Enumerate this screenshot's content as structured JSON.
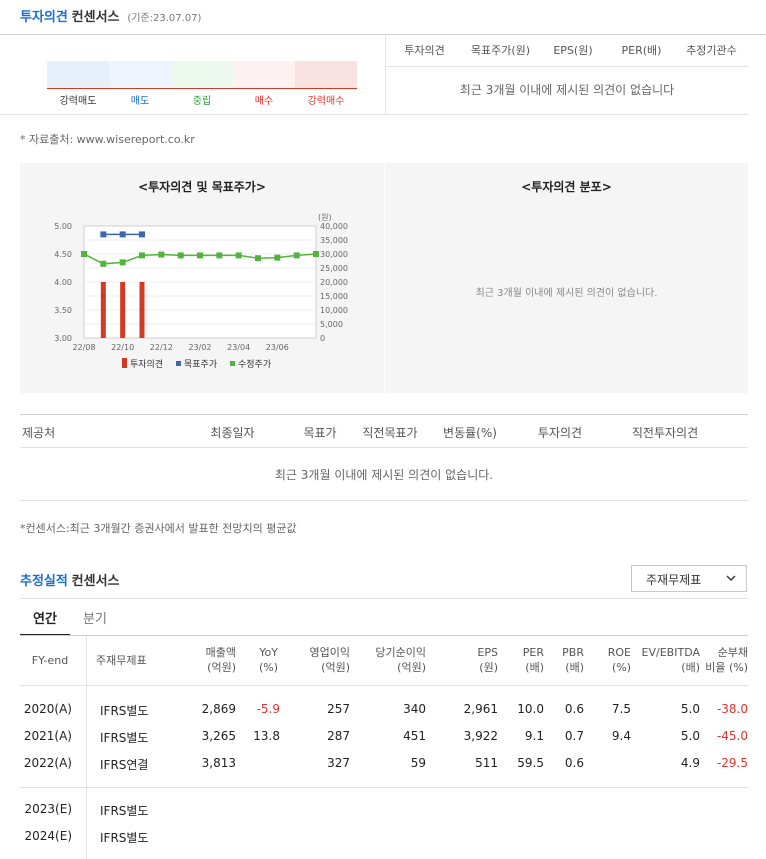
{
  "opinion_section": {
    "title_blue": "투자의견",
    "title_black": "컨센서스",
    "base_date": "(기준:23.07.07)",
    "scale": [
      {
        "label": "강력매도",
        "color": "#e7effb",
        "label_color": "#333333"
      },
      {
        "label": "매도",
        "color": "#eef4fd",
        "label_color": "#1a6fd4"
      },
      {
        "label": "중립",
        "color": "#edf8ef",
        "label_color": "#2e9c3a"
      },
      {
        "label": "매수",
        "color": "#fdf1f1",
        "label_color": "#e0322c"
      },
      {
        "label": "강력매수",
        "color": "#fbe2e2",
        "label_color": "#e0322c"
      }
    ],
    "headers": [
      "투자의견",
      "목표주가(원)",
      "EPS(원)",
      "PER(배)",
      "추정기관수"
    ],
    "empty_message": "최근 3개월 이내에 제시된 의견이 없습니다",
    "source": "* 자료출처: www.wisereport.co.kr"
  },
  "chart_panel": {
    "title": "<투자의견 및 목표주가>",
    "unit_label": "(원)",
    "legend": [
      "투자의견",
      "목표주가",
      "수정주가"
    ]
  },
  "chart_data": {
    "type": "bar+line",
    "x_ticks": [
      "22/08",
      "22/10",
      "22/12",
      "23/02",
      "23/04",
      "23/06"
    ],
    "left_axis": {
      "ticks": [
        "5.00",
        "4.50",
        "4.00",
        "3.50",
        "3.00"
      ],
      "range": [
        3.0,
        5.0
      ]
    },
    "right_axis": {
      "ticks": [
        "40,000",
        "35,000",
        "30,000",
        "25,000",
        "20,000",
        "15,000",
        "10,000",
        "5,000",
        "0"
      ],
      "range": [
        0,
        40000
      ]
    },
    "series": [
      {
        "name": "투자의견",
        "kind": "bar",
        "color": "#d23a24",
        "points": [
          [
            1,
            4.0
          ],
          [
            2,
            4.0
          ],
          [
            3,
            4.0
          ]
        ]
      },
      {
        "name": "목표주가",
        "kind": "line",
        "color": "#3c66b3",
        "points": [
          [
            1,
            37000
          ],
          [
            2,
            37000
          ],
          [
            3,
            37000
          ]
        ]
      },
      {
        "name": "수정주가",
        "kind": "line",
        "color": "#52b43c",
        "points": [
          [
            0,
            30000
          ],
          [
            1,
            26500
          ],
          [
            2,
            27000
          ],
          [
            3,
            29500
          ],
          [
            4,
            29800
          ],
          [
            5,
            29500
          ],
          [
            6,
            29500
          ],
          [
            7,
            29500
          ],
          [
            8,
            29500
          ],
          [
            9,
            28500
          ],
          [
            10,
            28700
          ],
          [
            11,
            29500
          ],
          [
            12,
            30000
          ]
        ]
      }
    ],
    "x_tick_positions": [
      0,
      2,
      4,
      6,
      8,
      10
    ]
  },
  "dist_panel": {
    "title": "<투자의견 분포>",
    "empty_message": "최근 3개월 이내에 제시된 의견이 없습니다."
  },
  "provider_table": {
    "headers": [
      "제공처",
      "최종일자",
      "목표가",
      "직전목표가",
      "변동률(%)",
      "투자의견",
      "직전투자의견"
    ],
    "empty_message": "최근 3개월 이내에 제시된 의견이 없습니다.",
    "footnote": "*컨센서스:최근 3개월간 증권사에서 발표한 전망치의 평균값"
  },
  "estimate_section": {
    "title_blue": "추정실적",
    "title_black": "컨센서스",
    "dropdown_value": "주재무제표",
    "tabs": [
      "연간",
      "분기"
    ],
    "col_headers": [
      [
        "FY-end",
        ""
      ],
      [
        "주재무제표",
        ""
      ],
      [
        "매출액",
        "(억원)"
      ],
      [
        "YoY",
        "(%)"
      ],
      [
        "영업이익",
        "(억원)"
      ],
      [
        "당기순이익",
        "(억원)"
      ],
      [
        "EPS",
        "(원)"
      ],
      [
        "PER",
        "(배)"
      ],
      [
        "PBR",
        "(배)"
      ],
      [
        "ROE",
        "(%)"
      ],
      [
        "EV/EBITDA",
        "(배)"
      ],
      [
        "순부채",
        "비율 (%)"
      ]
    ],
    "rows": [
      {
        "fy": "2020(A)",
        "fs": "IFRS별도",
        "rev": "2,869",
        "yoy": "-5.9",
        "op": "257",
        "net": "340",
        "eps": "2,961",
        "per": "10.0",
        "pbr": "0.6",
        "roe": "7.5",
        "ev": "5.0",
        "debt": "-38.0"
      },
      {
        "fy": "2021(A)",
        "fs": "IFRS별도",
        "rev": "3,265",
        "yoy": "13.8",
        "op": "287",
        "net": "451",
        "eps": "3,922",
        "per": "9.1",
        "pbr": "0.7",
        "roe": "9.4",
        "ev": "5.0",
        "debt": "-45.0"
      },
      {
        "fy": "2022(A)",
        "fs": "IFRS연결",
        "rev": "3,813",
        "yoy": "",
        "op": "327",
        "net": "59",
        "eps": "511",
        "per": "59.5",
        "pbr": "0.6",
        "roe": "",
        "ev": "4.9",
        "debt": "-29.5"
      },
      {
        "fy": "2023(E)",
        "fs": "IFRS별도",
        "rev": "",
        "yoy": "",
        "op": "",
        "net": "",
        "eps": "",
        "per": "",
        "pbr": "",
        "roe": "",
        "ev": "",
        "debt": ""
      },
      {
        "fy": "2024(E)",
        "fs": "IFRS별도",
        "rev": "",
        "yoy": "",
        "op": "",
        "net": "",
        "eps": "",
        "per": "",
        "pbr": "",
        "roe": "",
        "ev": "",
        "debt": ""
      }
    ]
  }
}
